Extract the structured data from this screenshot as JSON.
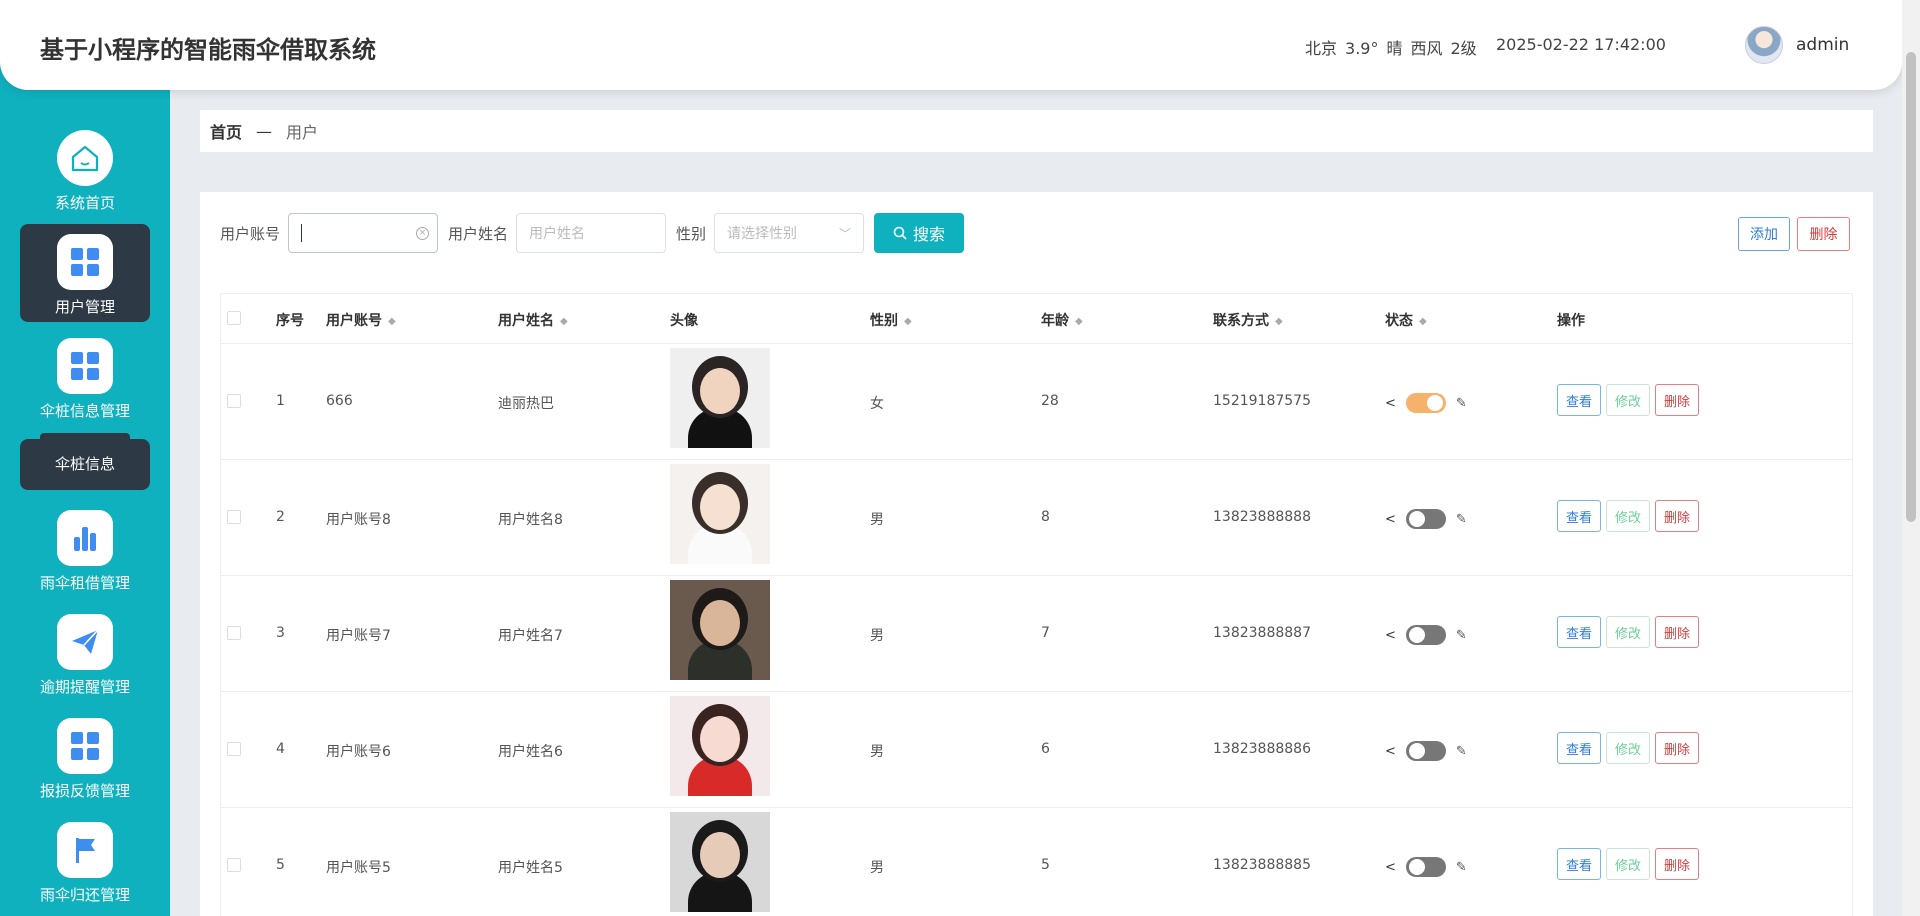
{
  "header": {
    "title": "基于小程序的智能雨伞借取系统",
    "weather": {
      "city": "北京",
      "temp": "3.9°",
      "condition": "晴",
      "wind": "西风",
      "level": "2级"
    },
    "datetime": "2025-02-22 17:42:00",
    "user": "admin"
  },
  "sidebar": {
    "items": [
      {
        "label": "系统首页",
        "icon": "home-icon"
      },
      {
        "label": "用户管理",
        "icon": "grid-icon",
        "active": true
      },
      {
        "label": "伞桩信息管理",
        "icon": "grid-icon"
      },
      {
        "label": "雨伞租借管理",
        "icon": "bar-chart-icon"
      },
      {
        "label": "逾期提醒管理",
        "icon": "paper-plane-icon"
      },
      {
        "label": "报损反馈管理",
        "icon": "grid-icon"
      },
      {
        "label": "雨伞归还管理",
        "icon": "flag-icon"
      }
    ],
    "sub_item": "伞桩信息"
  },
  "breadcrumb": {
    "home": "首页",
    "separator": "—",
    "current": "用户"
  },
  "search": {
    "account_label": "用户账号",
    "name_label": "用户姓名",
    "name_placeholder": "用户姓名",
    "gender_label": "性别",
    "gender_placeholder": "请选择性别",
    "search_button": "搜索",
    "add_button": "添加",
    "delete_button": "删除"
  },
  "table": {
    "headers": {
      "index": "序号",
      "account": "用户账号",
      "name": "用户姓名",
      "avatar": "头像",
      "gender": "性别",
      "age": "年龄",
      "phone": "联系方式",
      "status": "状态",
      "ops": "操作"
    },
    "rows": [
      {
        "index": "1",
        "account": "666",
        "name": "迪丽热巴",
        "gender": "女",
        "age": "28",
        "phone": "15219187575",
        "status_on": true
      },
      {
        "index": "2",
        "account": "用户账号8",
        "name": "用户姓名8",
        "gender": "男",
        "age": "8",
        "phone": "13823888888",
        "status_on": false
      },
      {
        "index": "3",
        "account": "用户账号7",
        "name": "用户姓名7",
        "gender": "男",
        "age": "7",
        "phone": "13823888887",
        "status_on": false
      },
      {
        "index": "4",
        "account": "用户账号6",
        "name": "用户姓名6",
        "gender": "男",
        "age": "6",
        "phone": "13823888886",
        "status_on": false
      },
      {
        "index": "5",
        "account": "用户账号5",
        "name": "用户姓名5",
        "gender": "男",
        "age": "5",
        "phone": "13823888885",
        "status_on": false
      }
    ],
    "op_labels": {
      "view": "查看",
      "edit": "修改",
      "delete": "删除"
    }
  },
  "colors": {
    "sidebar": "#0fb1bf",
    "active": "#2d3a46",
    "toggle_on": "#f6b26b"
  }
}
